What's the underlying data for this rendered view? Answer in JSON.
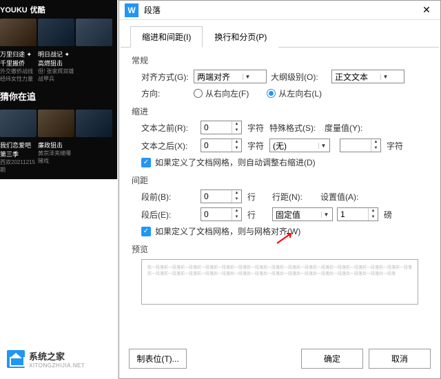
{
  "dialog": {
    "title": "段落",
    "app_icon_letter": "W",
    "tabs": {
      "indent": "缩进和间距(I)",
      "page": "换行和分页(P)"
    },
    "groups": {
      "general": "常规",
      "indent": "缩进",
      "spacing": "间距",
      "preview": "预览"
    },
    "general": {
      "align_label": "对齐方式(G):",
      "align_value": "两端对齐",
      "outline_label": "大纲级别(O):",
      "outline_value": "正文文本",
      "direction_label": "方向:",
      "rtl_label": "从右向左(F)",
      "ltr_label": "从左向右(L)"
    },
    "indent": {
      "before_label": "文本之前(R):",
      "before_value": "0",
      "after_label": "文本之后(X):",
      "after_value": "0",
      "unit_char": "字符",
      "special_label": "特殊格式(S):",
      "special_value": "(无)",
      "measure_label": "度量值(Y):",
      "measure_unit": "字符",
      "checkbox": "如果定义了文档网格，则自动调整右缩进(D)"
    },
    "spacing": {
      "before_label": "段前(B):",
      "before_value": "0",
      "after_label": "段后(E):",
      "after_value": "0",
      "unit_line": "行",
      "linespacing_label": "行距(N):",
      "linespacing_value": "固定值",
      "setvalue_label": "设置值(A):",
      "setvalue_value": "1",
      "setvalue_unit": "磅",
      "checkbox": "如果定义了文档网格，则与网格对齐(W)"
    },
    "preview_text": "前一段落前一段落前一段落前一段落前一段落前一段落前一段落前一段落前一段落前一段落前一段落前一段落前一段落前一段落前一段落前一段落前一段落前一段落前一段落前一段落后一段落后一段落后一段落后一段落后一段落后一段落后一段落后一段落后一段落后一段落后一段落",
    "buttons": {
      "tabs": "制表位(T)...",
      "ok": "确定",
      "cancel": "取消"
    }
  },
  "background": {
    "youku_brand": "YOUKU",
    "youku_cn": "优酷",
    "row1": [
      {
        "title": "万里归途 ✦ 千里搬侨",
        "sub": "外交撤侨战线经纬女性力量"
      },
      {
        "title": "明日战记 ✦ 高燃狙击",
        "sub": "但! 张家辉双雄战甲兵"
      }
    ],
    "recommend": "猜你在追",
    "row2": [
      {
        "title": "我们恋爱吧 第三季",
        "sub": "西双20211215期"
      },
      {
        "title": "廉政狙击",
        "sub": "黄宗泽夹缝曝赌戏"
      }
    ],
    "brand": {
      "name": "系统之家",
      "url": "XITONGZHIJIA.NET"
    }
  }
}
